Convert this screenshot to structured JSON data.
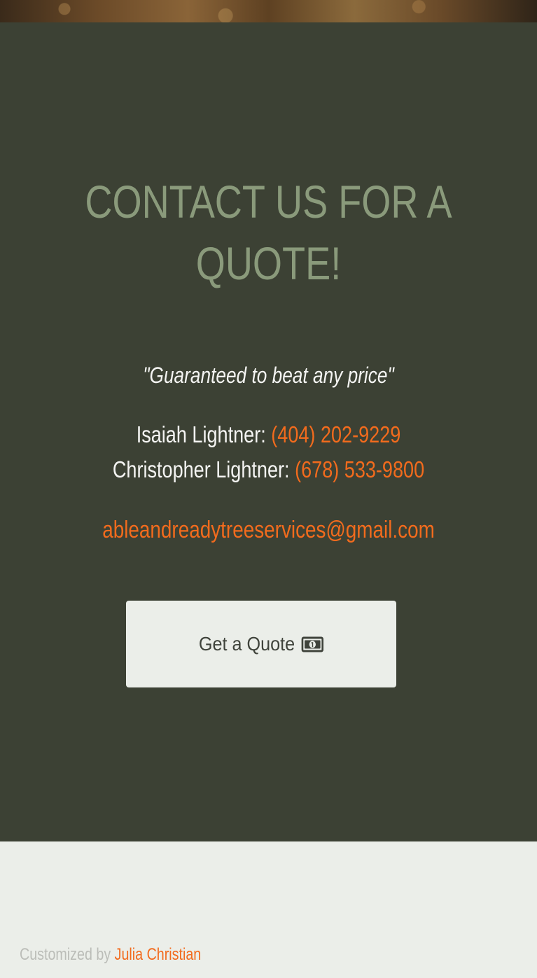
{
  "contact": {
    "heading": "CONTACT US FOR A QUOTE!",
    "tagline": "\"Guaranteed to beat any price\"",
    "contacts": [
      {
        "label": "Isaiah Lightner: ",
        "phone": "(404) 202-9229"
      },
      {
        "label": "Christopher Lightner: ",
        "phone": "(678) 533-9800"
      }
    ],
    "email": "ableandreadytreeservices@gmail.com",
    "quote_button": {
      "label": "Get a Quote",
      "icon": "money-icon"
    }
  },
  "footer": {
    "credit_prefix": "Customized by ",
    "credit_name": "Julia Christian"
  },
  "colors": {
    "section_background": "#3c4134",
    "heading": "#8a9a7b",
    "accent": "#f26b1d",
    "button_background": "#ebeee9",
    "button_text": "#3f433b",
    "footer_background": "#ebeee9",
    "footer_text": "#bbbdb8"
  }
}
